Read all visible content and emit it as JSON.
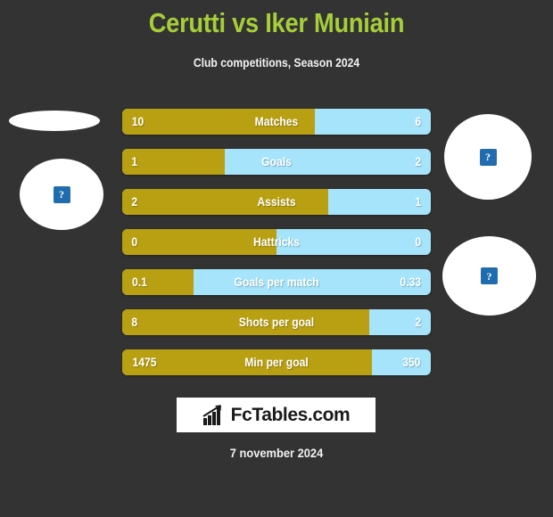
{
  "header": {
    "title": "Cerutti vs Iker Muniain",
    "subtitle": "Club competitions, Season 2024",
    "title_color": "#a6ce39"
  },
  "avatars": {
    "home_top": {
      "icon": "broken-image-icon",
      "glyph": "?"
    },
    "home_main": {
      "icon": "broken-image-icon",
      "glyph": "?"
    },
    "away_main": {
      "icon": "broken-image-icon",
      "glyph": "?"
    },
    "away_bottom": {
      "icon": "broken-image-icon",
      "glyph": "?"
    }
  },
  "colors": {
    "background": "#333333",
    "home_bar": "#b8a012",
    "away_bar": "#a5e4fa",
    "text": "#ffffff"
  },
  "chart_data": {
    "type": "bar",
    "title": "Cerutti vs Iker Muniain",
    "subtitle": "Club competitions, Season 2024",
    "orientation": "horizontal-diverging",
    "series": [
      {
        "name": "Cerutti",
        "color": "#b8a012",
        "values": [
          "10",
          "1",
          "2",
          "0",
          "0.1",
          "8",
          "1475"
        ]
      },
      {
        "name": "Iker Muniain",
        "color": "#a5e4fa",
        "values": [
          "6",
          "2",
          "1",
          "0",
          "0.33",
          "2",
          "350"
        ]
      }
    ],
    "categories": [
      "Matches",
      "Goals",
      "Assists",
      "Hattricks",
      "Goals per match",
      "Shots per goal",
      "Min per goal"
    ],
    "home_percents": [
      62.5,
      33.3,
      66.7,
      50,
      23.2,
      80,
      80.8
    ]
  },
  "stats": [
    {
      "label": "Matches",
      "home": "10",
      "away": "6",
      "home_pct": 62.5
    },
    {
      "label": "Goals",
      "home": "1",
      "away": "2",
      "home_pct": 33.3
    },
    {
      "label": "Assists",
      "home": "2",
      "away": "1",
      "home_pct": 66.7
    },
    {
      "label": "Hattricks",
      "home": "0",
      "away": "0",
      "home_pct": 50
    },
    {
      "label": "Goals per match",
      "home": "0.1",
      "away": "0.33",
      "home_pct": 23.2
    },
    {
      "label": "Shots per goal",
      "home": "8",
      "away": "2",
      "home_pct": 80
    },
    {
      "label": "Min per goal",
      "home": "1475",
      "away": "350",
      "home_pct": 80.8
    }
  ],
  "footer": {
    "brand_name": "FcTables.com",
    "brand_icon": "bar-chart-growth-icon",
    "date": "7 november 2024"
  }
}
